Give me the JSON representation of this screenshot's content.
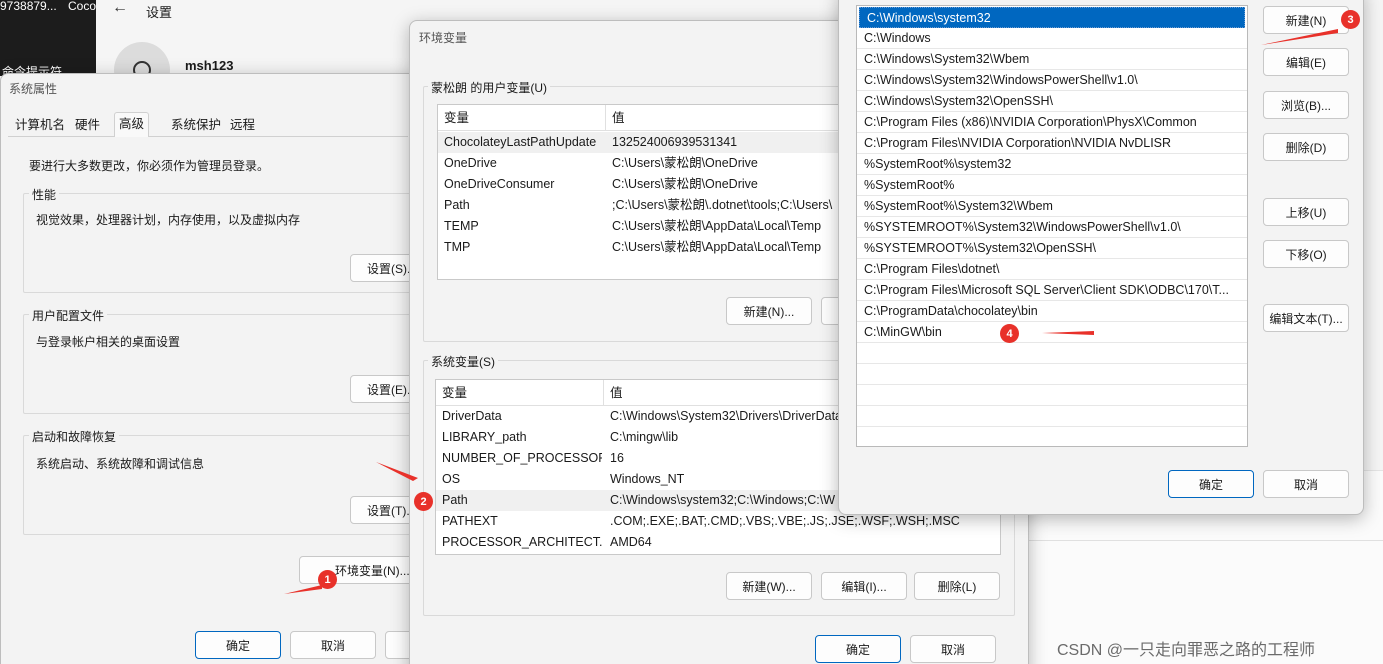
{
  "taskbar": {
    "left_text": "9738879...",
    "right_text": "Coco",
    "tip": "命令提示符"
  },
  "settings_app": {
    "title": "设置",
    "user": "msh123"
  },
  "sys_props": {
    "title": "系统属性",
    "tabs": [
      "计算机名",
      "硬件",
      "高级",
      "系统保护",
      "远程"
    ],
    "admin_note": "要进行大多数更改，你必须作为管理员登录。",
    "perf": {
      "title": "性能",
      "desc": "视觉效果，处理器计划，内存使用，以及虚拟内存",
      "button": "设置(S)..."
    },
    "profile": {
      "title": "用户配置文件",
      "desc": "与登录帐户相关的桌面设置",
      "button": "设置(E)..."
    },
    "startup": {
      "title": "启动和故障恢复",
      "desc": "系统启动、系统故障和调试信息",
      "button": "设置(T)..."
    },
    "env_button": "环境变量(N)...",
    "ok": "确定",
    "cancel": "取消"
  },
  "env_vars": {
    "title": "环境变量",
    "user_section": "蒙松朗 的用户变量(U)",
    "col_var": "变量",
    "col_val": "值",
    "user_rows": [
      {
        "name": "ChocolateyLastPathUpdate",
        "value": "132524006939531341"
      },
      {
        "name": "OneDrive",
        "value": "C:\\Users\\蒙松朗\\OneDrive"
      },
      {
        "name": "OneDriveConsumer",
        "value": "C:\\Users\\蒙松朗\\OneDrive"
      },
      {
        "name": "Path",
        "value": ";C:\\Users\\蒙松朗\\.dotnet\\tools;C:\\Users\\"
      },
      {
        "name": "TEMP",
        "value": "C:\\Users\\蒙松朗\\AppData\\Local\\Temp"
      },
      {
        "name": "TMP",
        "value": "C:\\Users\\蒙松朗\\AppData\\Local\\Temp"
      }
    ],
    "user_new": "新建(N)...",
    "sys_section": "系统变量(S)",
    "sys_rows": [
      {
        "name": "DriverData",
        "value": "C:\\Windows\\System32\\Drivers\\DriverData"
      },
      {
        "name": "LIBRARY_path",
        "value": "C:\\mingw\\lib"
      },
      {
        "name": "NUMBER_OF_PROCESSORS",
        "value": "16"
      },
      {
        "name": "OS",
        "value": "Windows_NT"
      },
      {
        "name": "Path",
        "value": "C:\\Windows\\system32;C:\\Windows;C:\\W"
      },
      {
        "name": "PATHEXT",
        "value": ".COM;.EXE;.BAT;.CMD;.VBS;.VBE;.JS;.JSE;.WSF;.WSH;.MSC"
      },
      {
        "name": "PROCESSOR_ARCHITECT...",
        "value": "AMD64"
      }
    ],
    "sys_new": "新建(W)...",
    "sys_edit": "编辑(I)...",
    "sys_delete": "删除(L)",
    "ok": "确定",
    "cancel": "取消"
  },
  "edit_path": {
    "entries": [
      "C:\\Windows\\system32",
      "C:\\Windows",
      "C:\\Windows\\System32\\Wbem",
      "C:\\Windows\\System32\\WindowsPowerShell\\v1.0\\",
      "C:\\Windows\\System32\\OpenSSH\\",
      "C:\\Program Files (x86)\\NVIDIA Corporation\\PhysX\\Common",
      "C:\\Program Files\\NVIDIA Corporation\\NVIDIA NvDLISR",
      "%SystemRoot%\\system32",
      "%SystemRoot%",
      "%SystemRoot%\\System32\\Wbem",
      "%SYSTEMROOT%\\System32\\WindowsPowerShell\\v1.0\\",
      "%SYSTEMROOT%\\System32\\OpenSSH\\",
      "C:\\Program Files\\dotnet\\",
      "C:\\Program Files\\Microsoft SQL Server\\Client SDK\\ODBC\\170\\T...",
      "C:\\ProgramData\\chocolatey\\bin",
      "C:\\MinGW\\bin"
    ],
    "new": "新建(N)",
    "edit": "编辑(E)",
    "browse": "浏览(B)...",
    "delete": "删除(D)",
    "up": "上移(U)",
    "down": "下移(O)",
    "edit_text": "编辑文本(T)...",
    "ok": "确定",
    "cancel": "取消"
  },
  "markers": [
    "1",
    "2",
    "3",
    "4"
  ],
  "watermark": "CSDN @一只走向罪恶之路的工程师",
  "colors": {
    "accent": "#0067c0",
    "marker": "#e8312a",
    "dialog_bg": "#f3f3f3"
  }
}
